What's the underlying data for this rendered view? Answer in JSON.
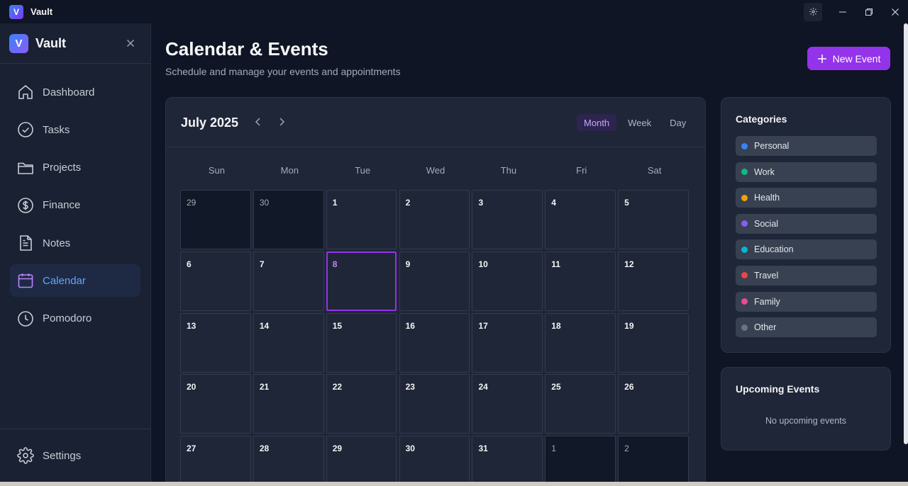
{
  "window": {
    "title": "Vault",
    "logo_letter": "V"
  },
  "sidebar": {
    "brand_letter": "V",
    "brand_name": "Vault",
    "items": [
      {
        "label": "Dashboard",
        "icon": "home-icon"
      },
      {
        "label": "Tasks",
        "icon": "check-circle-icon"
      },
      {
        "label": "Projects",
        "icon": "folder-icon"
      },
      {
        "label": "Finance",
        "icon": "dollar-circle-icon"
      },
      {
        "label": "Notes",
        "icon": "document-icon"
      },
      {
        "label": "Calendar",
        "icon": "calendar-icon",
        "active": true
      },
      {
        "label": "Pomodoro",
        "icon": "clock-icon"
      }
    ],
    "settings_label": "Settings"
  },
  "header": {
    "title": "Calendar & Events",
    "subtitle": "Schedule and manage your events and appointments",
    "new_event_label": "New Event"
  },
  "calendar": {
    "month_label": "July 2025",
    "views": [
      "Month",
      "Week",
      "Day"
    ],
    "active_view": "Month",
    "weekdays": [
      "Sun",
      "Mon",
      "Tue",
      "Wed",
      "Thu",
      "Fri",
      "Sat"
    ],
    "weeks": [
      [
        {
          "d": "29",
          "other": true
        },
        {
          "d": "30",
          "other": true
        },
        {
          "d": "1"
        },
        {
          "d": "2"
        },
        {
          "d": "3"
        },
        {
          "d": "4"
        },
        {
          "d": "5"
        }
      ],
      [
        {
          "d": "6"
        },
        {
          "d": "7"
        },
        {
          "d": "8",
          "today": true
        },
        {
          "d": "9"
        },
        {
          "d": "10"
        },
        {
          "d": "11"
        },
        {
          "d": "12"
        }
      ],
      [
        {
          "d": "13"
        },
        {
          "d": "14"
        },
        {
          "d": "15"
        },
        {
          "d": "16"
        },
        {
          "d": "17"
        },
        {
          "d": "18"
        },
        {
          "d": "19"
        }
      ],
      [
        {
          "d": "20"
        },
        {
          "d": "21"
        },
        {
          "d": "22"
        },
        {
          "d": "23"
        },
        {
          "d": "24"
        },
        {
          "d": "25"
        },
        {
          "d": "26"
        }
      ],
      [
        {
          "d": "27"
        },
        {
          "d": "28"
        },
        {
          "d": "29"
        },
        {
          "d": "30"
        },
        {
          "d": "31"
        },
        {
          "d": "1",
          "other": true
        },
        {
          "d": "2",
          "other": true
        }
      ]
    ]
  },
  "categories": {
    "title": "Categories",
    "items": [
      {
        "label": "Personal",
        "color": "#3b82f6"
      },
      {
        "label": "Work",
        "color": "#10b981"
      },
      {
        "label": "Health",
        "color": "#f59e0b"
      },
      {
        "label": "Social",
        "color": "#8b5cf6"
      },
      {
        "label": "Education",
        "color": "#06b6d4"
      },
      {
        "label": "Travel",
        "color": "#ef4444"
      },
      {
        "label": "Family",
        "color": "#ec4899"
      },
      {
        "label": "Other",
        "color": "#6b7280"
      }
    ]
  },
  "upcoming": {
    "title": "Upcoming Events",
    "empty_text": "No upcoming events"
  },
  "colors": {
    "accent": "#9333ea",
    "active_nav": "#60a5fa"
  }
}
